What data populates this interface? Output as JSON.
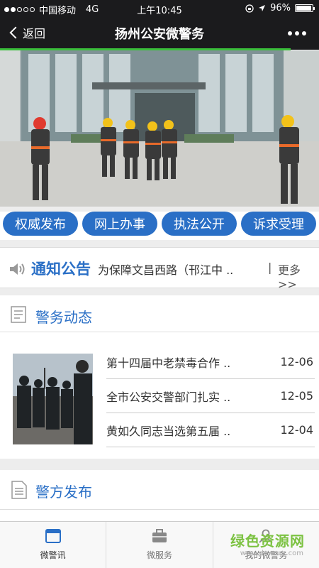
{
  "status": {
    "carrier": "中国移动",
    "network": "4G",
    "time": "上午10:45",
    "battery": "96%",
    "battery_level": 0.96
  },
  "nav": {
    "back_label": "返回",
    "title": "扬州公安微警务"
  },
  "quick_buttons": [
    "权威发布",
    "网上办事",
    "执法公开",
    "诉求受理"
  ],
  "notice": {
    "label": "通知公告",
    "text": "为保障文昌西路（邗江中 ..",
    "more": "更多>>"
  },
  "section_news": {
    "title": "警务动态",
    "items": [
      {
        "title": "第十四届中老禁毒合作 ..",
        "date": "12-06"
      },
      {
        "title": "全市公安交警部门扎实 ..",
        "date": "12-05"
      },
      {
        "title": "黄如久同志当选第五届 ..",
        "date": "12-04"
      }
    ]
  },
  "section_release": {
    "title": "警方发布"
  },
  "tabs": [
    {
      "label": "微警讯",
      "icon": "browser-icon",
      "active": true
    },
    {
      "label": "微服务",
      "icon": "briefcase-icon",
      "active": false
    },
    {
      "label": "我的微警务",
      "icon": "person-icon",
      "active": false
    }
  ],
  "watermark": {
    "text": "绿色资源网",
    "sub": "www.downcc.com"
  },
  "colors": {
    "accent": "#2a6fc6",
    "nav_bg": "#1b1b1d",
    "progress": "#3bbf3b"
  }
}
